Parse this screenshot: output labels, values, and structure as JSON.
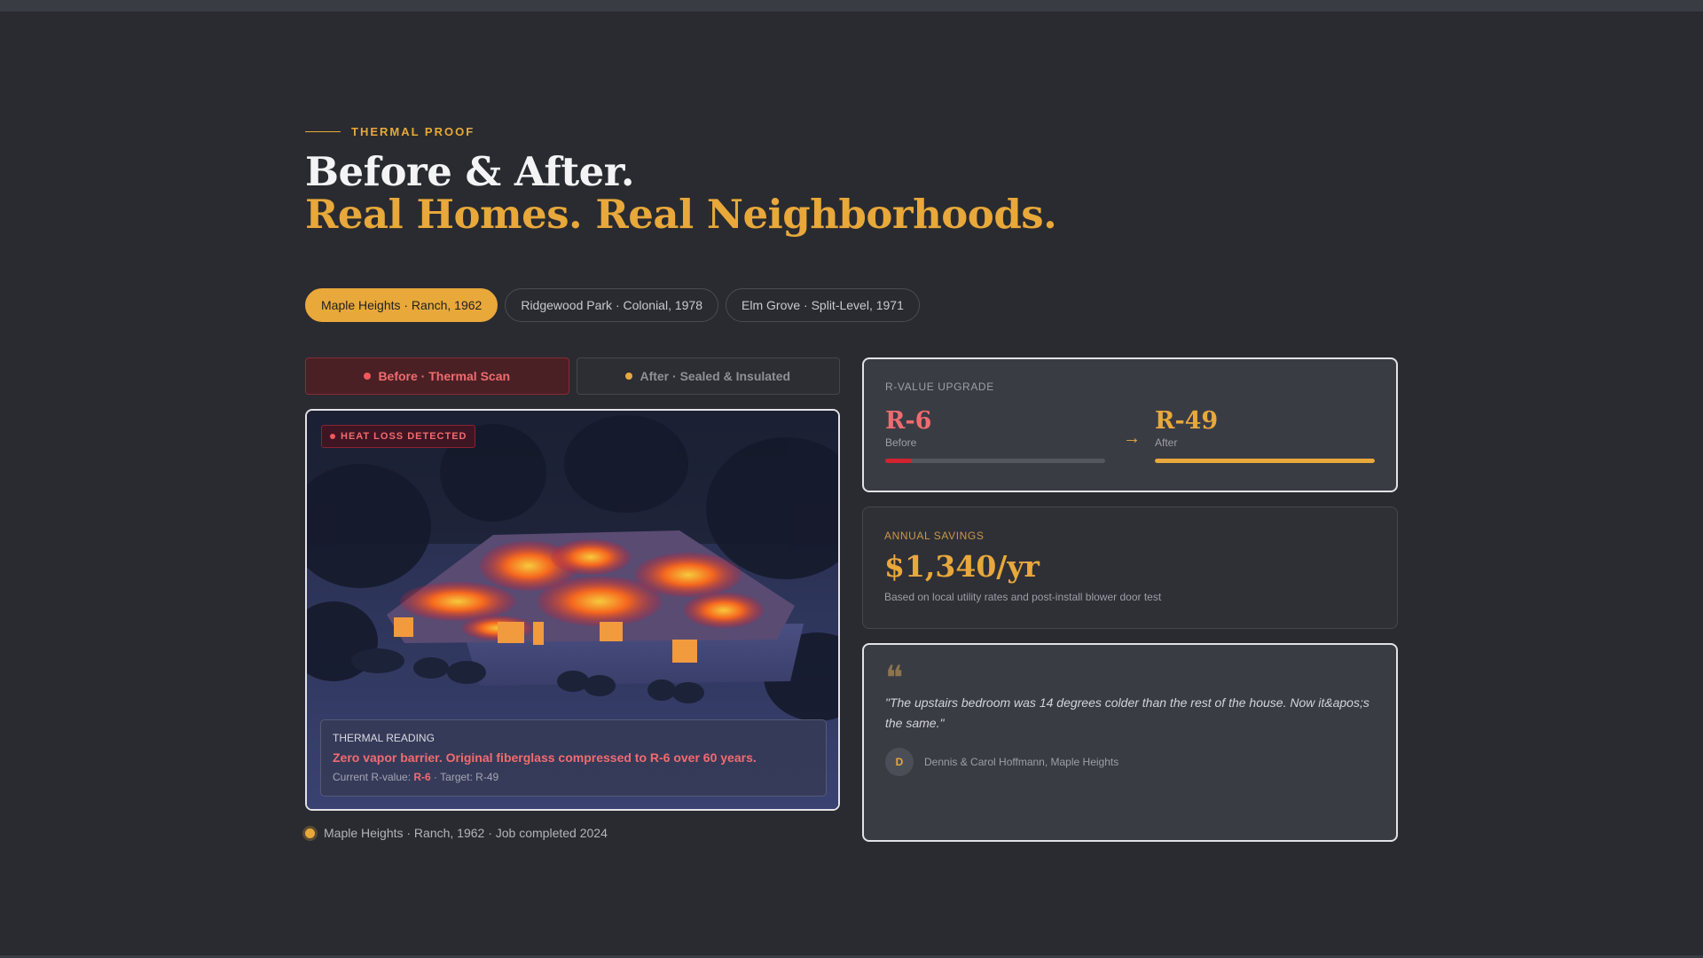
{
  "colors": {
    "background": "#2a2b30",
    "accent": "#e8a83a",
    "alert": "#f06b6e",
    "card": "#3a3c44"
  },
  "header": {
    "eyebrow": "THERMAL PROOF",
    "title_line1": "Before & After.",
    "title_line2": "Real Homes. Real Neighborhoods."
  },
  "neighborhoods": [
    {
      "label": "Maple Heights · Ranch, 1962",
      "active": true
    },
    {
      "label": "Ridgewood Park · Colonial, 1978",
      "active": false
    },
    {
      "label": "Elm Grove · Split-Level, 1971",
      "active": false
    }
  ],
  "view_toggle": {
    "before_label": "Before · Thermal Scan",
    "after_label": "After · Sealed & Insulated",
    "selected": "before"
  },
  "scan": {
    "badge": "HEAT LOSS DETECTED",
    "reading_label": "THERMAL READING",
    "reading_headline": "Zero vapor barrier. Original fiberglass compressed to R-6 over 60 years.",
    "current_prefix": "Current R-value: ",
    "current_value": "R-6",
    "target_text": " · Target: R-49",
    "caption": "Maple Heights · Ranch, 1962 · Job completed 2024",
    "image_icon": "thermal-house-image"
  },
  "r_value": {
    "label": "R-VALUE UPGRADE",
    "before_value": "R-6",
    "before_label": "Before",
    "before_fill_fraction": 0.12,
    "after_value": "R-49",
    "after_label": "After",
    "after_fill_fraction": 1.0,
    "arrow_icon": "arrow-right-icon"
  },
  "savings": {
    "label": "ANNUAL SAVINGS",
    "amount": "$1,340/yr",
    "note": "Based on local utility rates and post-install blower door test"
  },
  "testimonial": {
    "quote_icon": "quote-icon",
    "quote": "\"The upstairs bedroom was 14 degrees colder than the rest of the house. Now it&apos;s the same.\"",
    "avatar_initial": "D",
    "author": "Dennis & Carol Hoffmann, Maple Heights"
  }
}
